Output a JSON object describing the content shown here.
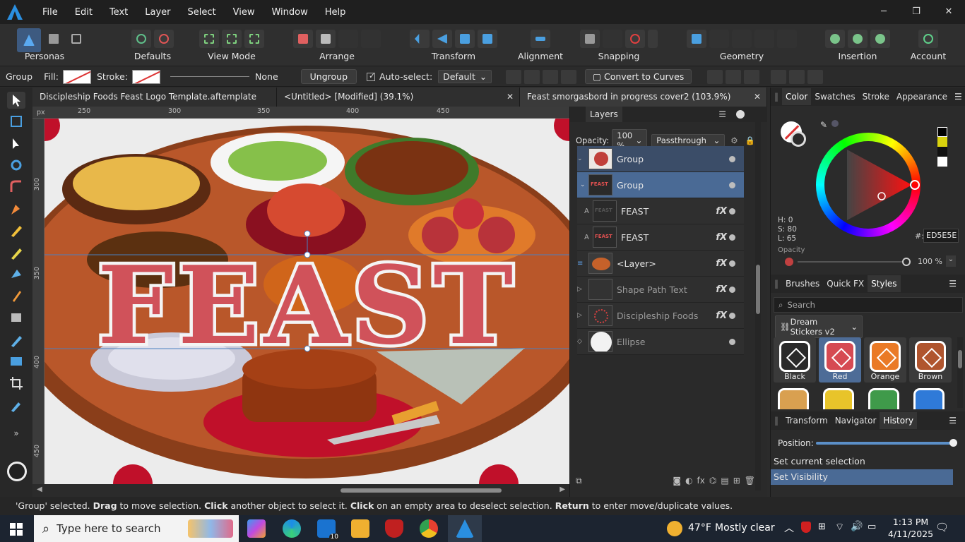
{
  "menu": [
    "File",
    "Edit",
    "Text",
    "Layer",
    "Select",
    "View",
    "Window",
    "Help"
  ],
  "window_controls": [
    "─",
    "❐",
    "✕"
  ],
  "toolbar": {
    "personas": "Personas",
    "groups": [
      "Defaults",
      "View Mode",
      "Arrange",
      "Transform",
      "Alignment",
      "Snapping",
      "Geometry",
      "Insertion",
      "Account"
    ]
  },
  "context": {
    "selection": "Group",
    "fill_label": "Fill:",
    "stroke_label": "Stroke:",
    "stroke_value": "None",
    "ungroup": "Ungroup",
    "autoselect": "Auto-select:",
    "autoselect_value": "Default",
    "convert": "Convert to Curves"
  },
  "tabs": [
    {
      "label": "Discipleship Foods Feast Logo Template.aftemplate [Modified]...",
      "close": "✕"
    },
    {
      "label": "<Untitled> [Modified] (39.1%)",
      "close": "✕"
    },
    {
      "label": "Feast smorgasbord in progress cover2 (103.9%)",
      "close": "✕"
    }
  ],
  "ruler": {
    "unit": "px",
    "h": [
      "250",
      "300",
      "350",
      "400",
      "450"
    ],
    "v": [
      "300",
      "350",
      "400",
      "450"
    ]
  },
  "canvas": {
    "headline": "FEAST"
  },
  "layers": {
    "title": "Layers",
    "opacity_label": "Opacity:",
    "opacity_value": "100 %",
    "blend": "Passthrough",
    "rows": [
      {
        "name": "Group",
        "fx": ""
      },
      {
        "name": "Group",
        "fx": ""
      },
      {
        "name": "FEAST",
        "fx": "fX"
      },
      {
        "name": "FEAST",
        "fx": "fX"
      },
      {
        "name": "<Layer>",
        "fx": "fX"
      },
      {
        "name": "Shape Path Text",
        "fx": "fX"
      },
      {
        "name": "Discipleship Foods",
        "fx": "fX"
      },
      {
        "name": "Ellipse",
        "fx": ""
      }
    ],
    "thumb_text": "FEAST"
  },
  "color_panel": {
    "tabs": [
      "Color",
      "Swatches",
      "Stroke",
      "Appearance"
    ],
    "h": "H: 0",
    "s": "S: 80",
    "l": "L: 65",
    "hex_label": "#:",
    "hex": "ED5E5E",
    "opacity_label": "Opacity",
    "opacity_value": "100 %",
    "accent": "#ED5E5E"
  },
  "styles_panel": {
    "tabs": [
      "Brushes",
      "Quick FX",
      "Styles"
    ],
    "search": "Search",
    "category": "Dream Stickers v2",
    "items": [
      {
        "name": "Black",
        "color": "#2a2a2a"
      },
      {
        "name": "Red",
        "color": "#d64a52"
      },
      {
        "name": "Orange",
        "color": "#ea7a26"
      },
      {
        "name": "Brown",
        "color": "#b0552e"
      }
    ]
  },
  "history_panel": {
    "tabs": [
      "Transform",
      "Navigator",
      "History"
    ],
    "position_label": "Position:",
    "entries": [
      "Set current selection",
      "Set Visibility"
    ]
  },
  "status": {
    "sel": "'Group' selected.",
    "drag": "Drag",
    "t1": " to move selection. ",
    "click": "Click",
    "t2": " another object to select it. ",
    "click2": "Click",
    "t3": " on an empty area to deselect selection. ",
    "ret": "Return",
    "t4": " to enter move/duplicate values."
  },
  "taskbar": {
    "search": "Type here to search",
    "weather_temp": "47°F",
    "weather_text": "Mostly clear",
    "time": "1:13 PM",
    "date": "4/11/2025",
    "mail_badge": "10"
  }
}
